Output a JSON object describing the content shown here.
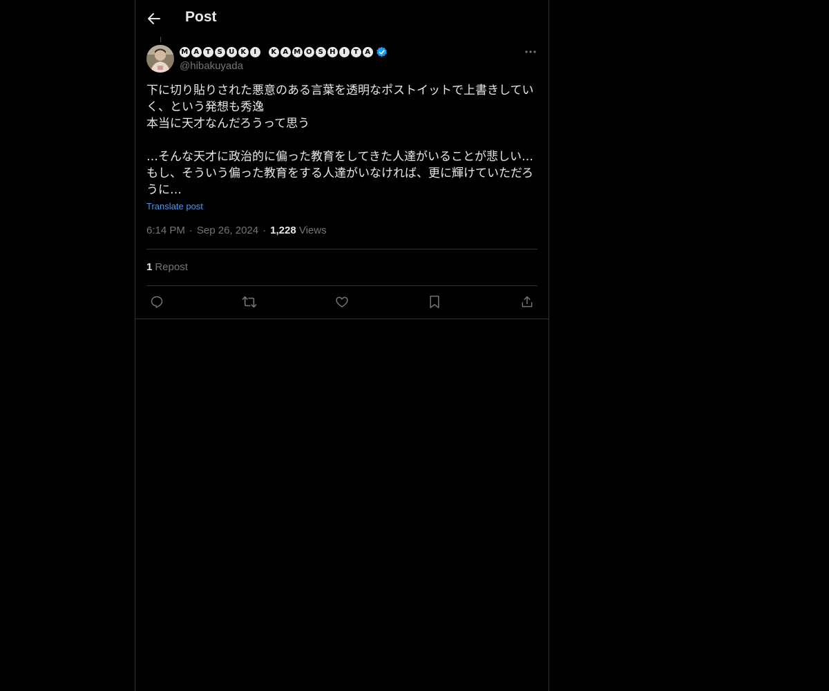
{
  "header": {
    "title": "Post",
    "back_icon": "arrow-left-icon"
  },
  "author": {
    "display_name_words": [
      [
        "M",
        "A",
        "T",
        "S",
        "U",
        "K",
        "I"
      ],
      [
        "K",
        "A",
        "M",
        "O",
        "S",
        "H",
        "I",
        "T",
        "A"
      ]
    ],
    "display_name": "MATSUKI KAMOSHITA",
    "handle": "@hibakuyada",
    "verified": true,
    "verified_color": "#1d9bf0"
  },
  "post": {
    "text": "下に切り貼りされた悪意のある言葉を透明なポストイットで上書きしていく、という発想も秀逸\n本当に天才なんだろうって思う\n\n…そんな天才に政治的に偏った教育をしてきた人達がいることが悲しい…\nもし、そういう偏った教育をする人達がいなければ、更に輝けていただろうに…",
    "translate_label": "Translate post",
    "time": "6:14 PM",
    "date": "Sep 26, 2024",
    "views_count": "1,228",
    "views_label": "Views",
    "separator": "·"
  },
  "stats": {
    "repost_count": "1",
    "repost_label": "Repost"
  },
  "actions": [
    "reply-icon",
    "repost-icon",
    "like-icon",
    "bookmark-icon",
    "share-icon"
  ],
  "colors": {
    "background": "#000000",
    "text": "#e7e9ea",
    "muted": "#71767b",
    "link": "#4a99e9",
    "border": "#2f3336"
  }
}
